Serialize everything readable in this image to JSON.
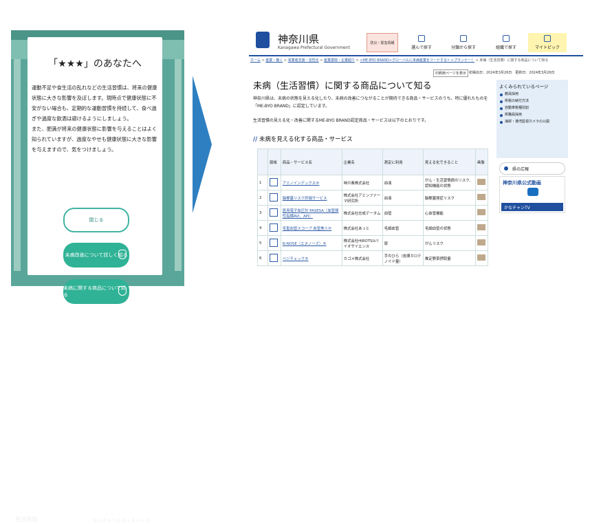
{
  "left_panel": {
    "modal_title": "「★★★」のあなたへ",
    "modal_body": "運動不足や食生活の乱れなどの生活習慣は、将来の健康状態に大きな影響を及ぼします。現時点で健康状態に不安がない場合も、定期的な運動習慣を持続して、食べ過ぎや過度な飲酒は避けるようにしましょう。\nまた、肥満が将来の健康状態に影響を与えることはよく知られていますが、過度なやせも健康状態に大きな影響を与えますので、気をつけましょう。",
    "close_label": "閉じる",
    "learn_more_label": "未病改善について詳しく知る",
    "products_label": "未病に関する商品について知る",
    "footer_left": "生活習慣",
    "footer_right": "メンタルヘルス・ストレス"
  },
  "header": {
    "site_name": "神奈川県",
    "site_sub": "Kanagawa Prefectural Government",
    "emergency": "防災・緊急情報",
    "nav": [
      "選んで探す",
      "分類から探す",
      "組織で探す",
      "マイトピック"
    ]
  },
  "breadcrumb": {
    "items": [
      "ホーム",
      "産業・働く",
      "事業者支援・活性化",
      "産業振興・企業紹介",
      "<ME-BYO BRAND>グローバルに未病産業をリードするトップランナー！",
      "未病（生活習慣）に関する商品について知る"
    ]
  },
  "page": {
    "print_label": "印刷用ページを表示",
    "dates": "初掲出日：2024年3月26日　更新日：2024年3月26日",
    "title": "未病（生活習慣）に関する商品について知る",
    "intro": "神奈川県は、未病の状態を見える化したり、未病の改善につながることが期待できる商品・サービスのうち、特に優れたものを「ME-BYO BRAND」に認定しています。",
    "intro2": "生活習慣の見える化・改善に関するME-BYO BRAND認定商品・サービスは以下のとおりです。",
    "section_title": "未病を見える化する商品・サービス"
  },
  "table": {
    "headers": [
      "",
      "領域",
      "商品・サービス名",
      "企業名",
      "測定に利用",
      "見える化できること",
      "画像"
    ],
    "rows": [
      {
        "no": "1",
        "product": "アミノインデックス®",
        "company": "味の素株式会社",
        "measure": "血液",
        "visible": "がん・生活習慣病のリスク、認知機能の状態"
      },
      {
        "no": "2",
        "product": "脳梗塞リスク評価サービス",
        "company": "株式会社アミンファーマ研究所",
        "measure": "血液",
        "visible": "脳梗塞発症リスク"
      },
      {
        "no": "3",
        "product": "医用電子血圧計 PASESA（血管弾性指標AVI、API）",
        "company": "株式会社志成データム",
        "measure": "血管",
        "visible": "心血管機能"
      },
      {
        "no": "4",
        "product": "毛髪血管スコープ 血管美人®",
        "company": "株式会社あっと",
        "measure": "毛細血管",
        "visible": "毛細血管の状態"
      },
      {
        "no": "5",
        "product": "N-NOSE（エヌノーズ）®",
        "company": "株式会社HIROTSUバイオサイエンス",
        "measure": "尿",
        "visible": "がんリスク"
      },
      {
        "no": "6",
        "product": "ベジチェック®",
        "company": "カゴメ株式会社",
        "measure": "手のひら（皮膚カロテノイド量）",
        "visible": "推定野菜摂取量"
      }
    ]
  },
  "sidebar": {
    "title": "よくみられているページ",
    "items": [
      "教員採用",
      "県税の納付方法",
      "自動車税種別割",
      "県職員採用",
      "海岸・港湾監視カメラの公開"
    ],
    "koho": "県の広報",
    "video_title": "神奈川県公式動画",
    "video_bar": "かなチャンTV"
  }
}
